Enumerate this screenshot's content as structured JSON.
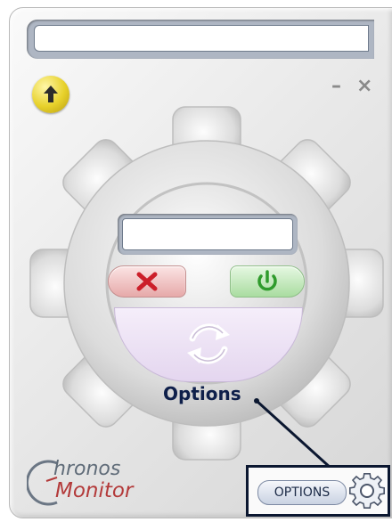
{
  "main_window": {
    "title_field_value": "",
    "display_field_value": "",
    "minimize_label": "–",
    "close_label": "×"
  },
  "callout": {
    "label": "Options"
  },
  "logo": {
    "line1": "hronos",
    "line2": "Monitor"
  },
  "options_panel": {
    "button_label": "OPTIONS"
  },
  "icons": {
    "up": "arrow-up-icon",
    "stop": "x-icon",
    "power": "power-icon",
    "refresh": "refresh-icon",
    "gear": "gear-icon"
  },
  "colors": {
    "stop_button": "#e6a9a9",
    "power_button": "#a9dca0",
    "refresh_button": "#e4d6ef",
    "up_button": "#e7d12a",
    "callout_line": "#0b1730"
  }
}
